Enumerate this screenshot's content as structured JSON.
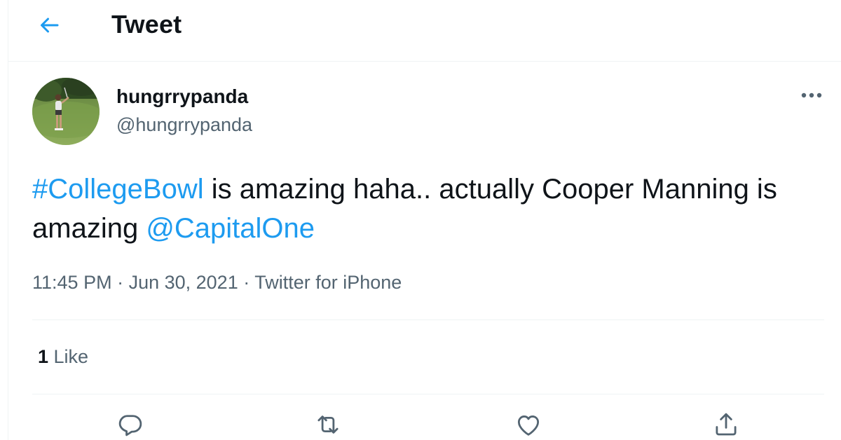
{
  "header": {
    "back_icon": "arrow-left-icon",
    "title": "Tweet"
  },
  "tweet": {
    "author": {
      "display_name": "hungrrypanda",
      "handle": "@hungrrypanda",
      "avatar": "profile-photo-golfer"
    },
    "text": {
      "hashtag": "#CollegeBowl",
      "part1": " is amazing haha.. actually Cooper Manning is amazing ",
      "mention": "@CapitalOne"
    },
    "meta": {
      "time": "11:45 PM",
      "separator1": " · ",
      "date": "Jun 30, 2021",
      "separator2": " · ",
      "source": "Twitter for iPhone"
    },
    "stats": {
      "likes_count": "1",
      "likes_label": " Like"
    },
    "more_icon": "more-horizontal-icon"
  },
  "actions": {
    "reply_icon": "reply-icon",
    "retweet_icon": "retweet-icon",
    "like_icon": "heart-icon",
    "share_icon": "share-icon"
  },
  "colors": {
    "accent": "#1d9bf0",
    "text_primary": "#0f1419",
    "text_secondary": "#536471",
    "border": "#eff3f4"
  }
}
